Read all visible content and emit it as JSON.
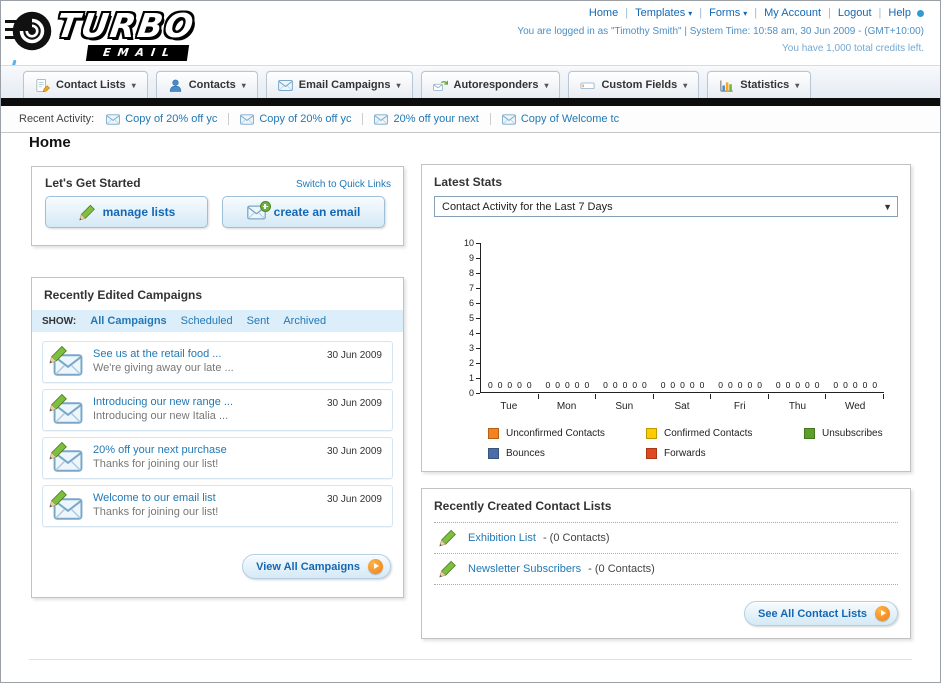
{
  "header": {
    "logo_text": "TURBO",
    "logo_sub": "EMAIL",
    "links": [
      {
        "label": "Home",
        "dropdown": false
      },
      {
        "label": "Templates",
        "dropdown": true
      },
      {
        "label": "Forms",
        "dropdown": true
      },
      {
        "label": "My Account",
        "dropdown": false
      },
      {
        "label": "Logout",
        "dropdown": false
      },
      {
        "label": "Help",
        "dropdown": false
      }
    ],
    "login_info": "You are logged in as \"Timothy Smith\" | System Time: 10:58 am, 30 Jun 2009 - (GMT+10:00)",
    "credits_info": "You have 1,000 total credits left."
  },
  "nav": {
    "tabs": [
      {
        "label": "Contact Lists",
        "icon": "contact-lists-icon"
      },
      {
        "label": "Contacts",
        "icon": "contacts-icon"
      },
      {
        "label": "Email Campaigns",
        "icon": "email-campaigns-icon"
      },
      {
        "label": "Autoresponders",
        "icon": "autoresponders-icon"
      },
      {
        "label": "Custom Fields",
        "icon": "custom-fields-icon"
      },
      {
        "label": "Statistics",
        "icon": "statistics-icon"
      }
    ]
  },
  "recent_activity": {
    "label": "Recent Activity:",
    "items": [
      {
        "label": "Copy of 20% off yc"
      },
      {
        "label": "Copy of 20% off yc"
      },
      {
        "label": "20% off your next"
      },
      {
        "label": "Copy of Welcome tc"
      }
    ]
  },
  "page_title": "Home",
  "get_started": {
    "title": "Let's Get Started",
    "switch_link": "Switch to Quick Links",
    "manage_lists_label": "manage lists",
    "create_email_label": "create an email"
  },
  "campaigns": {
    "title": "Recently Edited Campaigns",
    "show_label": "SHOW:",
    "filters": [
      {
        "label": "All Campaigns",
        "active": true
      },
      {
        "label": "Scheduled",
        "active": false
      },
      {
        "label": "Sent",
        "active": false
      },
      {
        "label": "Archived",
        "active": false
      }
    ],
    "items": [
      {
        "title": "See us at the retail food ...",
        "subtitle": "We're giving away our late ...",
        "date": "30 Jun 2009"
      },
      {
        "title": "Introducing our new range ...",
        "subtitle": "Introducing our new Italia ...",
        "date": "30 Jun 2009"
      },
      {
        "title": "20% off your next purchase",
        "subtitle": "Thanks for joining our list!",
        "date": "30 Jun 2009"
      },
      {
        "title": "Welcome to our email list",
        "subtitle": "Thanks for joining our list!",
        "date": "30 Jun 2009"
      }
    ],
    "view_all_label": "View All Campaigns"
  },
  "stats": {
    "title": "Latest Stats",
    "dropdown_value": "Contact Activity for the Last 7 Days"
  },
  "chart_data": {
    "type": "bar",
    "title": "Contact Activity for the Last 7 Days",
    "categories": [
      "Tue",
      "Mon",
      "Sun",
      "Sat",
      "Fri",
      "Thu",
      "Wed"
    ],
    "series": [
      {
        "name": "Unconfirmed Contacts",
        "color": "#F5821F",
        "values": [
          0,
          0,
          0,
          0,
          0,
          0,
          0
        ]
      },
      {
        "name": "Confirmed Contacts",
        "color": "#FFCC00",
        "values": [
          0,
          0,
          0,
          0,
          0,
          0,
          0
        ]
      },
      {
        "name": "Unsubscribes",
        "color": "#5C9F29",
        "values": [
          0,
          0,
          0,
          0,
          0,
          0,
          0
        ]
      },
      {
        "name": "Bounces",
        "color": "#4A6FA8",
        "values": [
          0,
          0,
          0,
          0,
          0,
          0,
          0
        ]
      },
      {
        "name": "Forwards",
        "color": "#E0481F",
        "values": [
          0,
          0,
          0,
          0,
          0,
          0,
          0
        ]
      }
    ],
    "ylim": [
      0,
      10
    ],
    "ytick_step": 1,
    "xlabel": "",
    "ylabel": "",
    "grid": false,
    "legend_position": "bottom",
    "data_labels": true
  },
  "contact_lists": {
    "title": "Recently Created Contact Lists",
    "items": [
      {
        "name": "Exhibition List",
        "detail": "- (0 Contacts)"
      },
      {
        "name": "Newsletter Subscribers",
        "detail": "- (0 Contacts)"
      }
    ],
    "see_all_label": "See All Contact Lists"
  }
}
